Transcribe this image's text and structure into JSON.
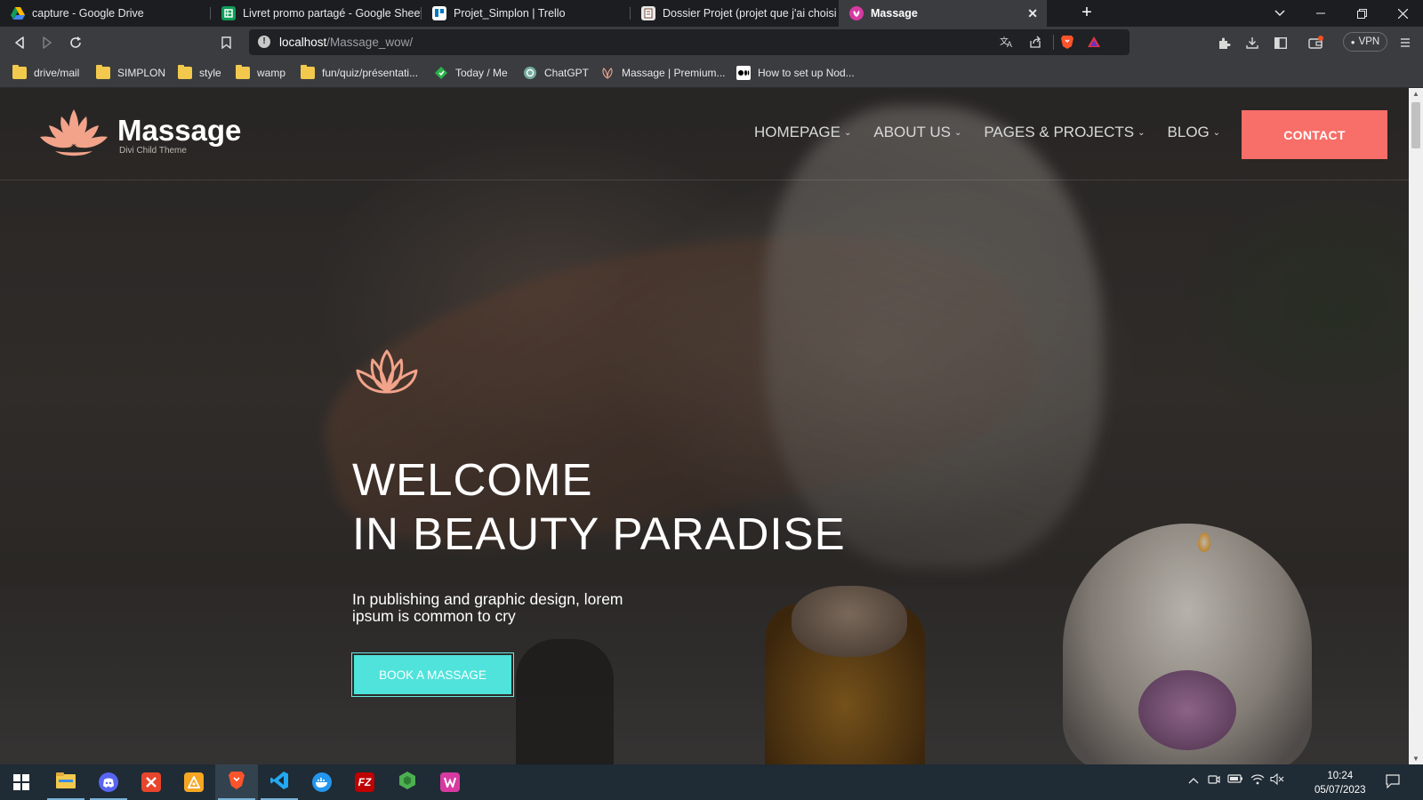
{
  "browser": {
    "tabs": [
      {
        "label": "capture - Google Drive",
        "icon": "google-drive-icon"
      },
      {
        "label": "Livret promo partagé - Google Sheets",
        "icon": "google-sheets-icon"
      },
      {
        "label": "Projet_Simplon | Trello",
        "icon": "trello-icon"
      },
      {
        "label": "Dossier Projet (projet que j'ai choisi de",
        "icon": "document-icon"
      },
      {
        "label": "Massage",
        "icon": "massage-site-icon",
        "active": true
      }
    ],
    "address": {
      "host": "localhost",
      "path": "/Massage_wow/"
    },
    "vpn_label": "VPN",
    "bookmarks": [
      {
        "label": "drive/mail",
        "icon": "folder-icon"
      },
      {
        "label": "SIMPLON",
        "icon": "folder-icon"
      },
      {
        "label": "style",
        "icon": "folder-icon"
      },
      {
        "label": "wamp",
        "icon": "folder-icon"
      },
      {
        "label": "fun/quiz/présentati...",
        "icon": "folder-icon"
      },
      {
        "label": "Today / Me",
        "icon": "today-icon"
      },
      {
        "label": "ChatGPT",
        "icon": "chatgpt-icon"
      },
      {
        "label": "Massage | Premium...",
        "icon": "massage-bookmark-icon"
      },
      {
        "label": "How to set up Nod...",
        "icon": "medium-icon"
      }
    ]
  },
  "site": {
    "logo": {
      "name": "Massage",
      "tagline": "Divi Child Theme"
    },
    "nav": [
      {
        "label": "HOMEPAGE"
      },
      {
        "label": "ABOUT US"
      },
      {
        "label": "PAGES & PROJECTS"
      },
      {
        "label": "BLOG"
      }
    ],
    "contact_label": "CONTACT",
    "hero": {
      "title_line1": "WELCOME",
      "title_line2": "IN BEAUTY PARADISE",
      "subtitle": "In publishing and graphic design, lorem ipsum is common to cry",
      "cta_label": "BOOK A MASSAGE"
    },
    "colors": {
      "accent": "#f86e68",
      "cta": "#4fe3db",
      "lotus": "#f2a38a"
    }
  },
  "taskbar": {
    "apps": [
      {
        "name": "file-explorer-icon"
      },
      {
        "name": "discord-icon"
      },
      {
        "name": "xmind-icon"
      },
      {
        "name": "sublime-merge-icon"
      },
      {
        "name": "brave-browser-icon",
        "active": true
      },
      {
        "name": "vscode-icon"
      },
      {
        "name": "docker-icon"
      },
      {
        "name": "filezilla-icon"
      },
      {
        "name": "nodejs-icon"
      },
      {
        "name": "wampserver-icon"
      }
    ],
    "time": "10:24",
    "date": "05/07/2023"
  }
}
